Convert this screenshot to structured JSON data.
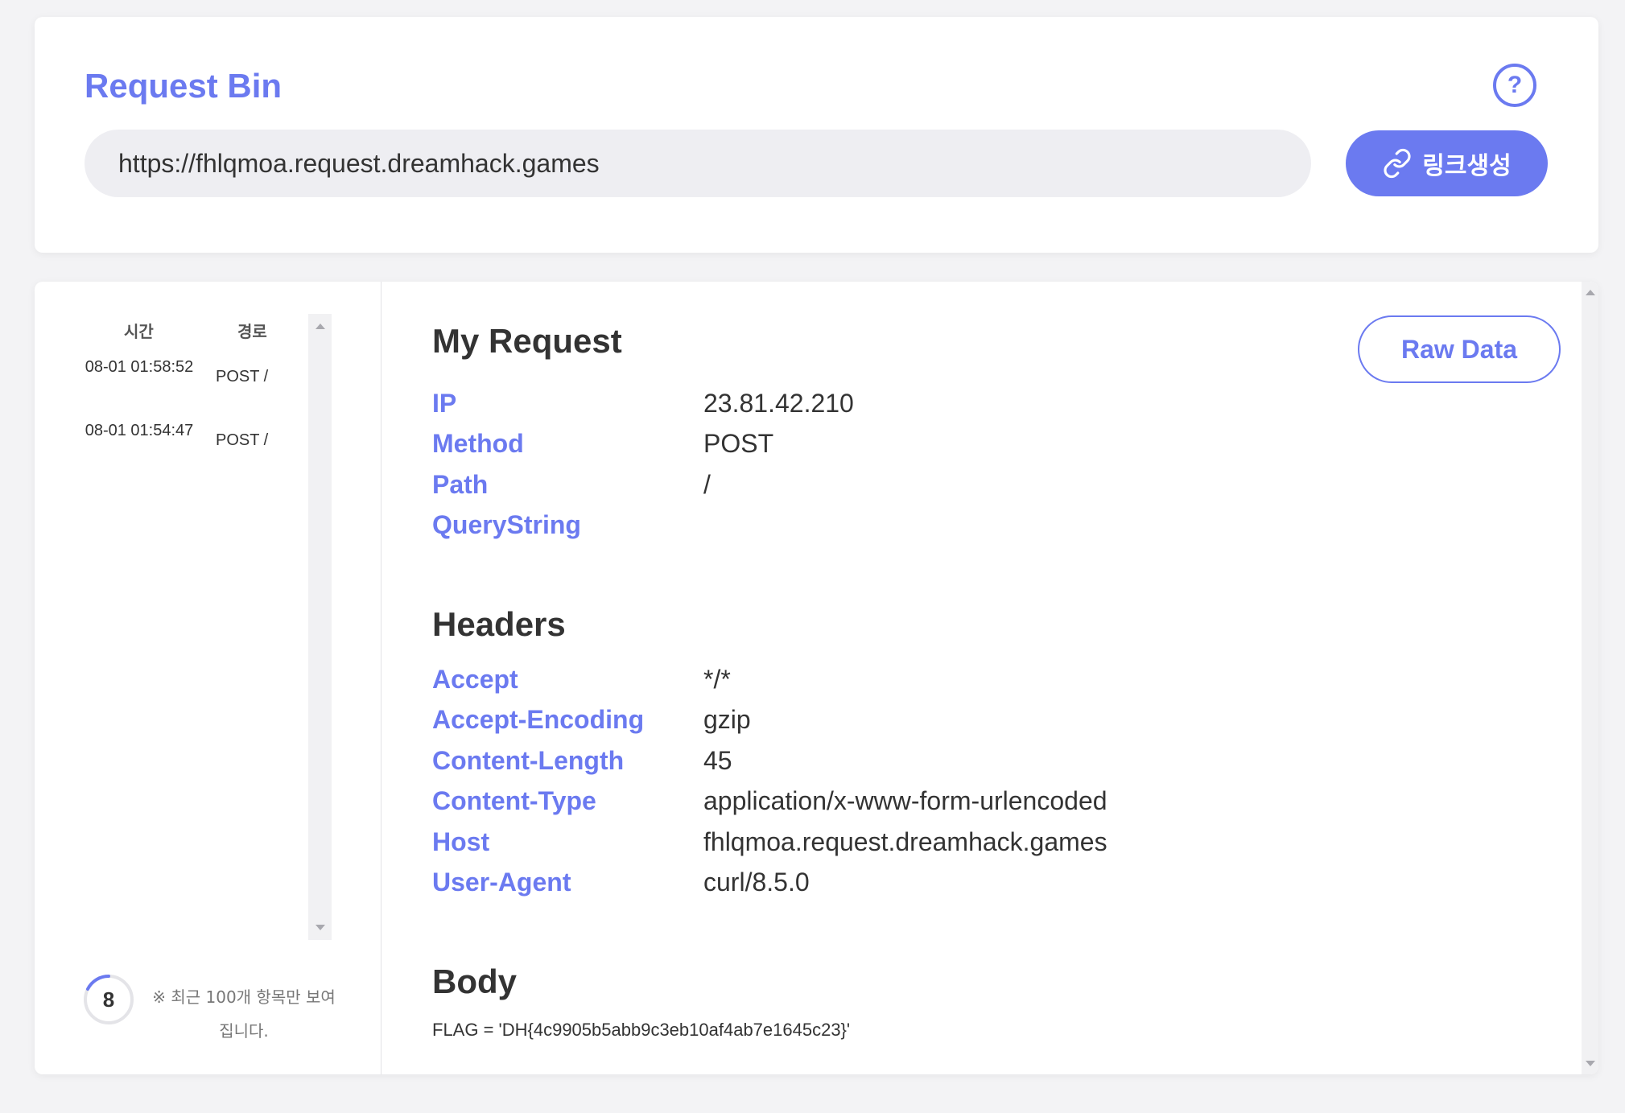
{
  "header": {
    "title": "Request Bin",
    "help_symbol": "?",
    "url_value": "https://fhlqmoa.request.dreamhack.games",
    "create_link_label": "링크생성"
  },
  "sidebar": {
    "columns": {
      "time": "시간",
      "path": "경로"
    },
    "requests": [
      {
        "time": "08-01 01:58:52",
        "path": "POST /"
      },
      {
        "time": "08-01 01:54:47",
        "path": "POST /"
      }
    ],
    "count": "8",
    "limit_note": "※ 최근 100개 항목만 보여집니다."
  },
  "detail": {
    "request_title": "My Request",
    "raw_data_label": "Raw Data",
    "request_fields": [
      {
        "key": "IP",
        "value": "23.81.42.210"
      },
      {
        "key": "Method",
        "value": "POST"
      },
      {
        "key": "Path",
        "value": "/"
      },
      {
        "key": "QueryString",
        "value": ""
      }
    ],
    "headers_title": "Headers",
    "headers": [
      {
        "key": "Accept",
        "value": "*/*"
      },
      {
        "key": "Accept-Encoding",
        "value": "gzip"
      },
      {
        "key": "Content-Length",
        "value": "45"
      },
      {
        "key": "Content-Type",
        "value": "application/x-www-form-urlencoded"
      },
      {
        "key": "Host",
        "value": "fhlqmoa.request.dreamhack.games"
      },
      {
        "key": "User-Agent",
        "value": "curl/8.5.0"
      }
    ],
    "body_title": "Body",
    "body": "FLAG = 'DH{4c9905b5abb9c3eb10af4ab7e1645c23}'"
  },
  "colors": {
    "accent": "#6b7af0",
    "background": "#f3f3f5",
    "input_bg": "#eeeef2"
  }
}
